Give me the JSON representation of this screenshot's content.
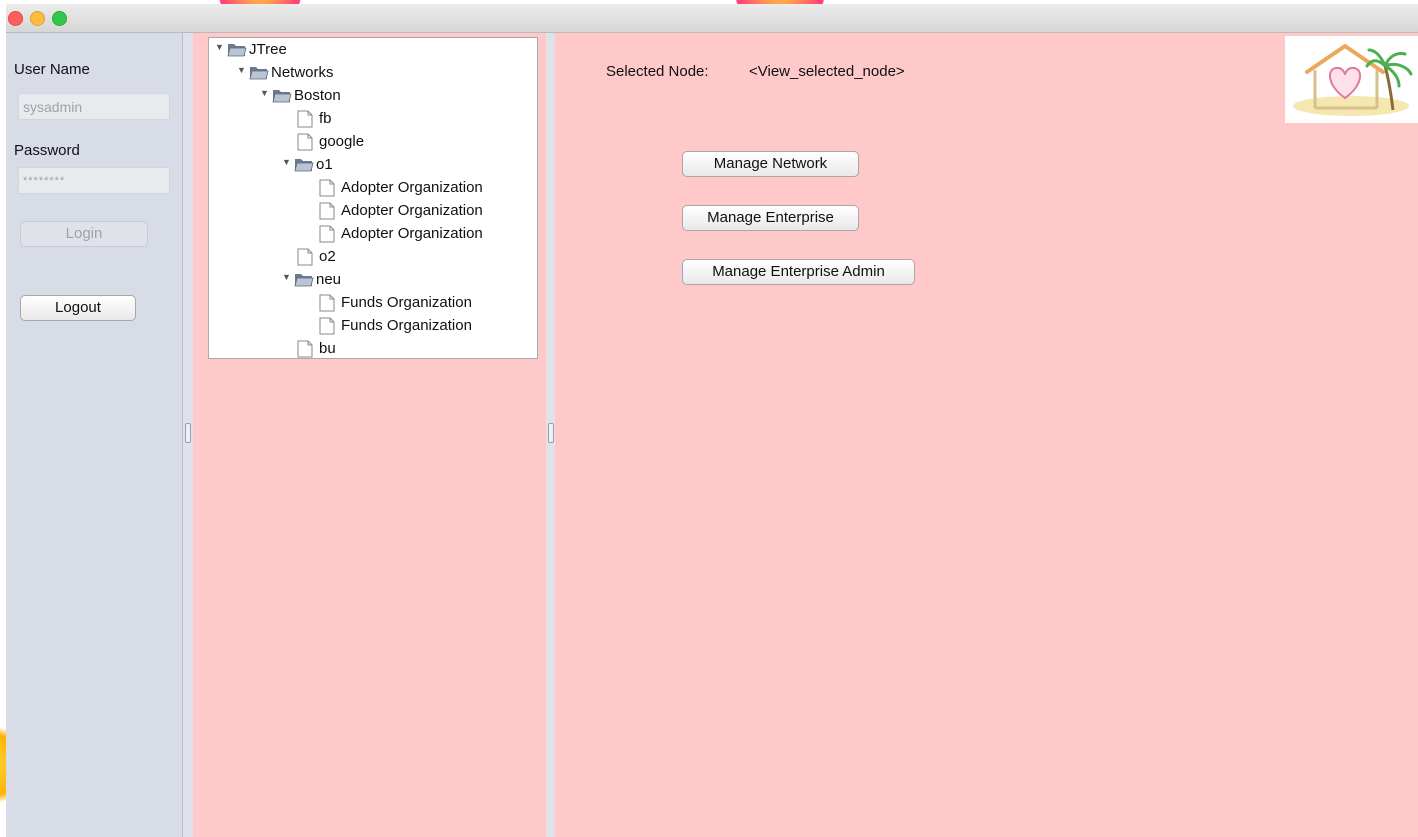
{
  "login": {
    "user_label": "User Name",
    "user_value": "sysadmin",
    "password_label": "Password",
    "password_value": "********",
    "login_button": "Login",
    "logout_button": "Logout"
  },
  "tree": {
    "root": "JTree",
    "networks": "Networks",
    "boston": "Boston",
    "fb": "fb",
    "google": "google",
    "o1": "o1",
    "o1_children": [
      "Adopter Organization",
      "Adopter Organization",
      "Adopter Organization"
    ],
    "o2": "o2",
    "neu": "neu",
    "neu_children": [
      "Funds Organization",
      "Funds Organization"
    ],
    "bu": "bu"
  },
  "main": {
    "selected_label": "Selected Node:",
    "selected_value": "<View_selected_node>",
    "manage_network": "Manage Network",
    "manage_enterprise": "Manage Enterprise",
    "manage_enterprise_admin": "Manage Enterprise Admin"
  },
  "colors": {
    "pane_background": "#ffc9c9",
    "left_panel": "#d8dce6",
    "tree_background": "#ffffff"
  },
  "icons": {
    "folder": "folder-open-icon",
    "file": "file-icon",
    "expand": "triangle-down-icon",
    "logo": "house-heart-palm-logo"
  }
}
